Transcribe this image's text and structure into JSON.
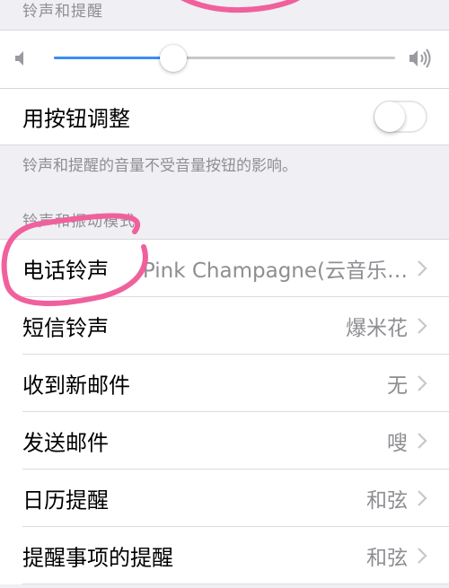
{
  "ringtones_section": {
    "header": "铃声和提醒"
  },
  "volume": {
    "level": 0.35
  },
  "change_with_buttons": {
    "label": "用按钮调整",
    "enabled": false
  },
  "note": "铃声和提醒的音量不受音量按钮的影响。",
  "patterns_section": {
    "header": "铃声和振动模式"
  },
  "sounds": [
    {
      "label": "电话铃声",
      "value": "Pink Champagne(云音乐…"
    },
    {
      "label": "短信铃声",
      "value": "爆米花"
    },
    {
      "label": "收到新邮件",
      "value": "无"
    },
    {
      "label": "发送邮件",
      "value": "嗖"
    },
    {
      "label": "日历提醒",
      "value": "和弦"
    },
    {
      "label": "提醒事项的提醒",
      "value": "和弦"
    }
  ],
  "colors": {
    "accent": "#3b8df5",
    "annotation": "#f0609c",
    "secondary_text": "#8e8e93"
  },
  "icons": {
    "volume_low": "speaker-low-icon",
    "volume_high": "speaker-high-icon",
    "chevron": "chevron-right-icon"
  }
}
